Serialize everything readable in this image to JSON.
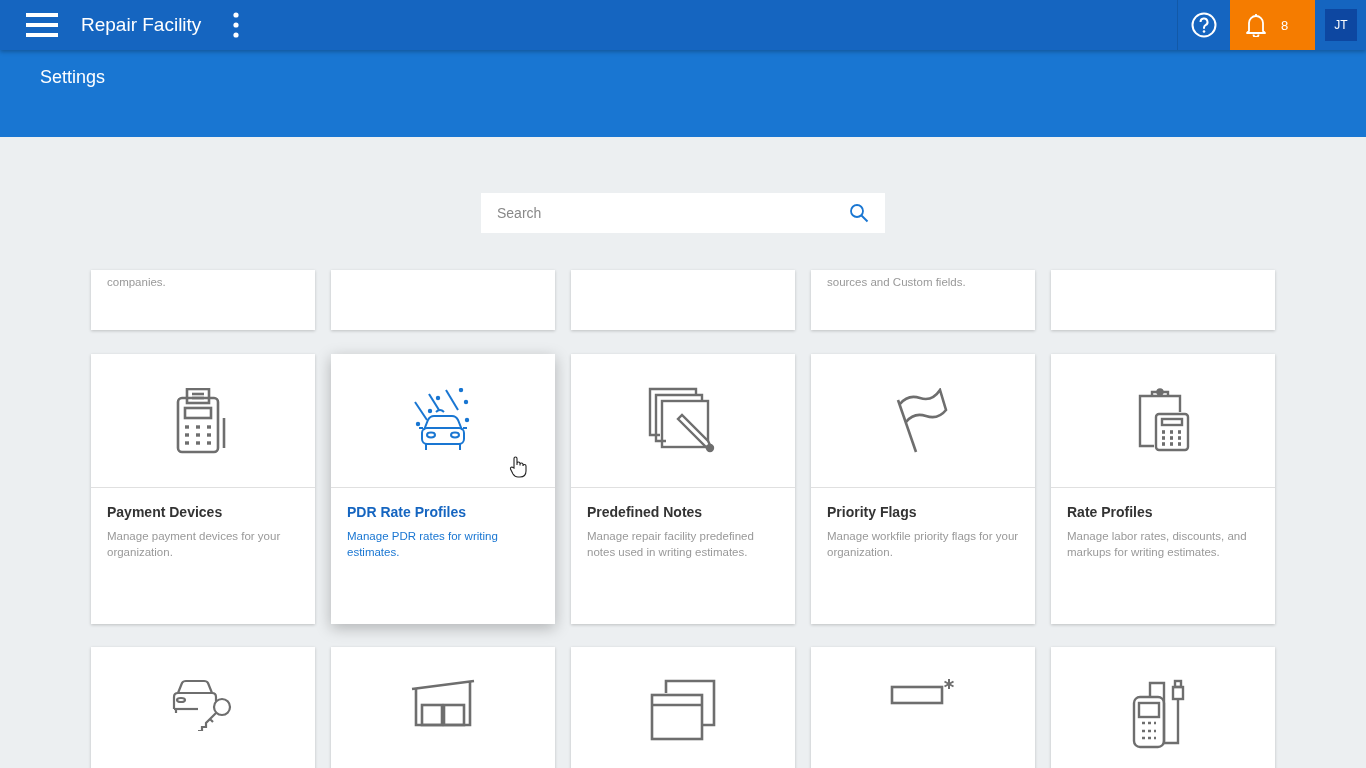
{
  "header": {
    "title": "Repair Facility",
    "notification_count": "8",
    "avatar_initials": "JT"
  },
  "page_title": "Settings",
  "search": {
    "placeholder": "Search"
  },
  "top_cards": [
    {
      "kind": "text",
      "description": "companies."
    },
    {
      "kind": "blank"
    },
    {
      "kind": "blank"
    },
    {
      "kind": "text",
      "description": "sources and Custom fields."
    },
    {
      "kind": "blank"
    }
  ],
  "cards": [
    {
      "title": "Payment Devices",
      "description": "Manage payment devices for your organization.",
      "selected": false
    },
    {
      "title": "PDR Rate Profiles",
      "description": "Manage PDR rates for writing estimates.",
      "selected": true
    },
    {
      "title": "Predefined Notes",
      "description": "Manage repair facility predefined notes used in writing estimates.",
      "selected": false
    },
    {
      "title": "Priority Flags",
      "description": "Manage workfile priority flags for your organization.",
      "selected": false
    },
    {
      "title": "Rate Profiles",
      "description": "Manage labor rates, discounts, and markups for writing estimates.",
      "selected": false
    }
  ],
  "bottom_cards": [
    {
      "selected": false
    },
    {
      "selected": false
    },
    {
      "selected": false
    },
    {
      "selected": false
    },
    {
      "selected": false
    }
  ]
}
